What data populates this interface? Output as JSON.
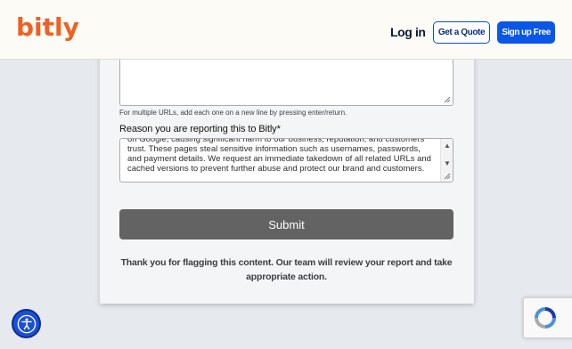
{
  "header": {
    "logo_text": "bitly",
    "login_label": "Log in",
    "quote_label": "Get a Quote",
    "signup_label": "Sign up Free",
    "brand_color": "#ee6123",
    "primary_color": "#0a56e6"
  },
  "form": {
    "urls_value": "",
    "urls_hint": "For multiple URLs, add each one on a new line by pressing enter/return.",
    "reason_label": "Reason you are reporting this to Bitly*",
    "reason_value": "on Google, causing significant harm to our business, reputation, and customers' trust. These pages steal sensitive information such as usernames, passwords, and payment details. We request an immediate takedown of all related URLs and cached versions to prevent further abuse and protect our brand and customers.",
    "submit_label": "Submit",
    "thanks_message": "Thank you for flagging this content. Our team will review your report and take appropriate action."
  },
  "widgets": {
    "accessibility_icon": "accessibility-icon",
    "recaptcha_icon": "recaptcha-icon"
  }
}
